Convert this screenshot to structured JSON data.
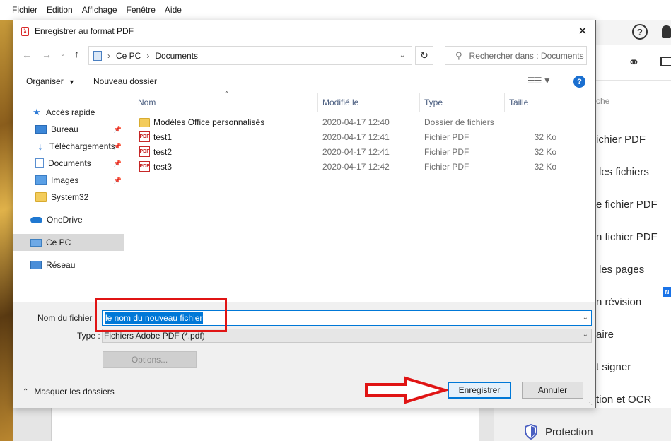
{
  "app": {
    "menu": [
      "Fichier",
      "Edition",
      "Affichage",
      "Fenêtre",
      "Aide"
    ],
    "tools_search_partial": "che",
    "tools": [
      "ichier PDF",
      "les fichiers",
      "e fichier PDF",
      "n fichier PDF",
      "les pages",
      "n révision",
      "aire",
      "t signer",
      "tion et OCR"
    ],
    "protection_label": "Protection",
    "new_badge": "N"
  },
  "dialog": {
    "title": "Enregistrer au format PDF",
    "breadcrumb": [
      "Ce PC",
      "Documents"
    ],
    "search_placeholder": "Rechercher dans : Documents",
    "commands": {
      "organize": "Organiser",
      "new_folder": "Nouveau dossier"
    },
    "nav": {
      "quick_access": "Accès rapide",
      "items": [
        {
          "label": "Bureau",
          "pinned": true
        },
        {
          "label": "Téléchargements",
          "pinned": true
        },
        {
          "label": "Documents",
          "pinned": true
        },
        {
          "label": "Images",
          "pinned": true
        },
        {
          "label": "System32",
          "pinned": false
        }
      ],
      "onedrive": "OneDrive",
      "this_pc": "Ce PC",
      "network": "Réseau"
    },
    "columns": {
      "name": "Nom",
      "modified": "Modifié le",
      "type": "Type",
      "size": "Taille"
    },
    "files": [
      {
        "name": "Modèles Office personnalisés",
        "modified": "2020-04-17 12:40",
        "type": "Dossier de fichiers",
        "size": "",
        "kind": "folder"
      },
      {
        "name": "test1",
        "modified": "2020-04-17 12:41",
        "type": "Fichier PDF",
        "size": "32 Ko",
        "kind": "pdf"
      },
      {
        "name": "test2",
        "modified": "2020-04-17 12:41",
        "type": "Fichier PDF",
        "size": "32 Ko",
        "kind": "pdf"
      },
      {
        "name": "test3",
        "modified": "2020-04-17 12:42",
        "type": "Fichier PDF",
        "size": "32 Ko",
        "kind": "pdf"
      }
    ],
    "filename_label": "Nom du fichier :",
    "filename_value": "le nom du nouveau fichier",
    "type_label": "Type :",
    "type_value": "Fichiers Adobe PDF (*.pdf)",
    "options_label": "Options...",
    "hide_folders_label": "Masquer les dossiers",
    "save_label": "Enregistrer",
    "cancel_label": "Annuler"
  },
  "colors": {
    "accent": "#0078d7",
    "annotation": "#e01414",
    "pdf_red": "#c62828",
    "folder": "#f3cc5b"
  }
}
